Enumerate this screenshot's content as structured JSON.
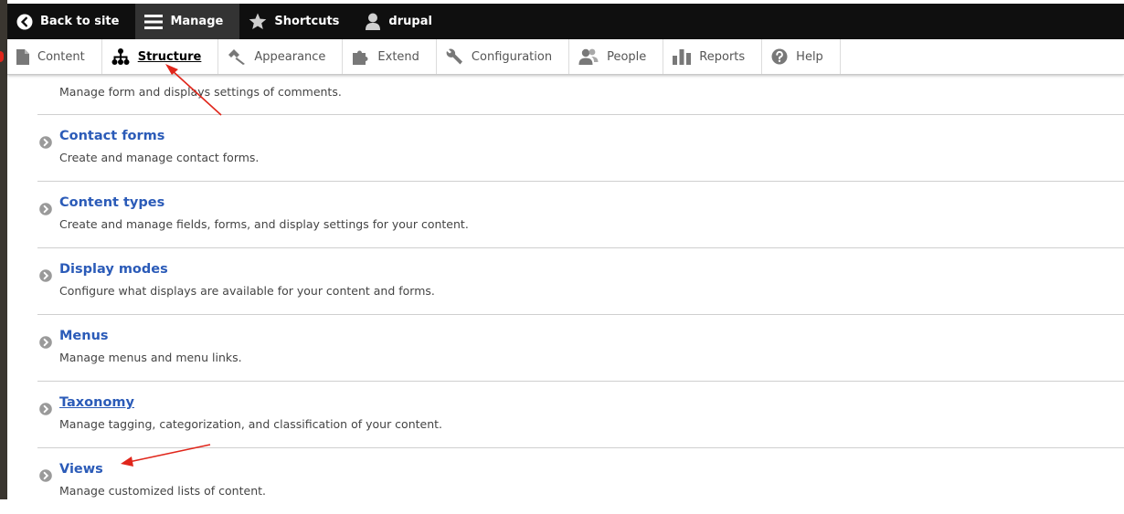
{
  "toolbar": {
    "back": "Back to site",
    "manage": "Manage",
    "shortcuts": "Shortcuts",
    "user": "drupal"
  },
  "tray": {
    "items": [
      "Content",
      "Structure",
      "Appearance",
      "Extend",
      "Configuration",
      "People",
      "Reports",
      "Help"
    ],
    "active": "Structure"
  },
  "list": {
    "first_desc": "Manage form and displays settings of comments.",
    "items": [
      {
        "title": "Contact forms",
        "desc": "Create and manage contact forms."
      },
      {
        "title": "Content types",
        "desc": "Create and manage fields, forms, and display settings for your content."
      },
      {
        "title": "Display modes",
        "desc": "Configure what displays are available for your content and forms."
      },
      {
        "title": "Menus",
        "desc": "Manage menus and menu links."
      },
      {
        "title": "Taxonomy",
        "desc": "Manage tagging, categorization, and classification of your content."
      },
      {
        "title": "Views",
        "desc": "Manage customized lists of content."
      }
    ]
  },
  "colors": {
    "link": "#2b5bb8",
    "toolbar_bg": "#0f0f0f",
    "annotation_arrow": "#e0261b"
  },
  "icons": [
    "back-circle-icon",
    "hamburger-icon",
    "star-icon",
    "user-icon",
    "page-icon",
    "sitemap-icon",
    "brush-icon",
    "puzzle-icon",
    "wrench-icon",
    "people-icon",
    "bar-chart-icon",
    "help-icon",
    "chevron-circle-icon"
  ]
}
